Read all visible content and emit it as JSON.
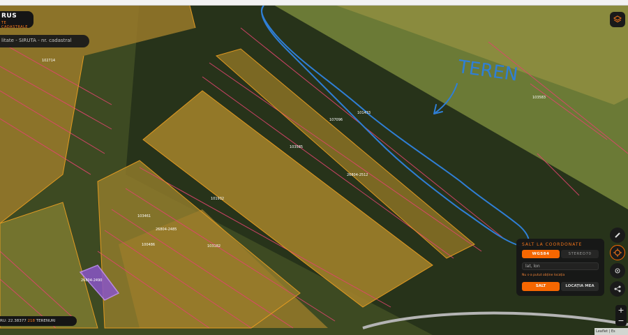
{
  "header": {
    "brand": "RUS",
    "brand_sub": "TE CADASTRALE",
    "search_text": "litate - SIRUTA - nr. cadastral"
  },
  "annotation": {
    "text": "TEREN",
    "color": "#2f7fd6"
  },
  "parcels": [
    {
      "id": "102714"
    },
    {
      "id": "107096"
    },
    {
      "id": "103585"
    },
    {
      "id": "26804-2512"
    },
    {
      "id": "101433"
    },
    {
      "id": "103583"
    },
    {
      "id": "101932"
    },
    {
      "id": "103461"
    },
    {
      "id": "26804-2485"
    },
    {
      "id": "100486"
    },
    {
      "id": "103182"
    },
    {
      "id": "26804-2490"
    }
  ],
  "coord_panel": {
    "title": "SALT LA COORDONATE",
    "tabs": [
      "WGS84",
      "STEREO70"
    ],
    "input_placeholder": "lat, lon",
    "error": "Nu s-a putut obține locația",
    "go_label": "SALT",
    "location_label": "LOCAȚIA MEA"
  },
  "status": {
    "coords": "RU: 22.38377",
    "count": "218",
    "unit": "TERENURI"
  },
  "zoom": {
    "in": "+",
    "out": "−"
  },
  "attribution": "Leaflet | Es",
  "icons": {
    "layers": "layers-icon",
    "ruler": "ruler-icon",
    "crosshair": "crosshair-icon",
    "locate": "locate-icon",
    "share": "share-icon"
  },
  "colors": {
    "accent": "#ff6a00",
    "parcel_outline": "#e0446e",
    "field_highlight": "#c79a1e",
    "annotation": "#2f7fd6"
  }
}
